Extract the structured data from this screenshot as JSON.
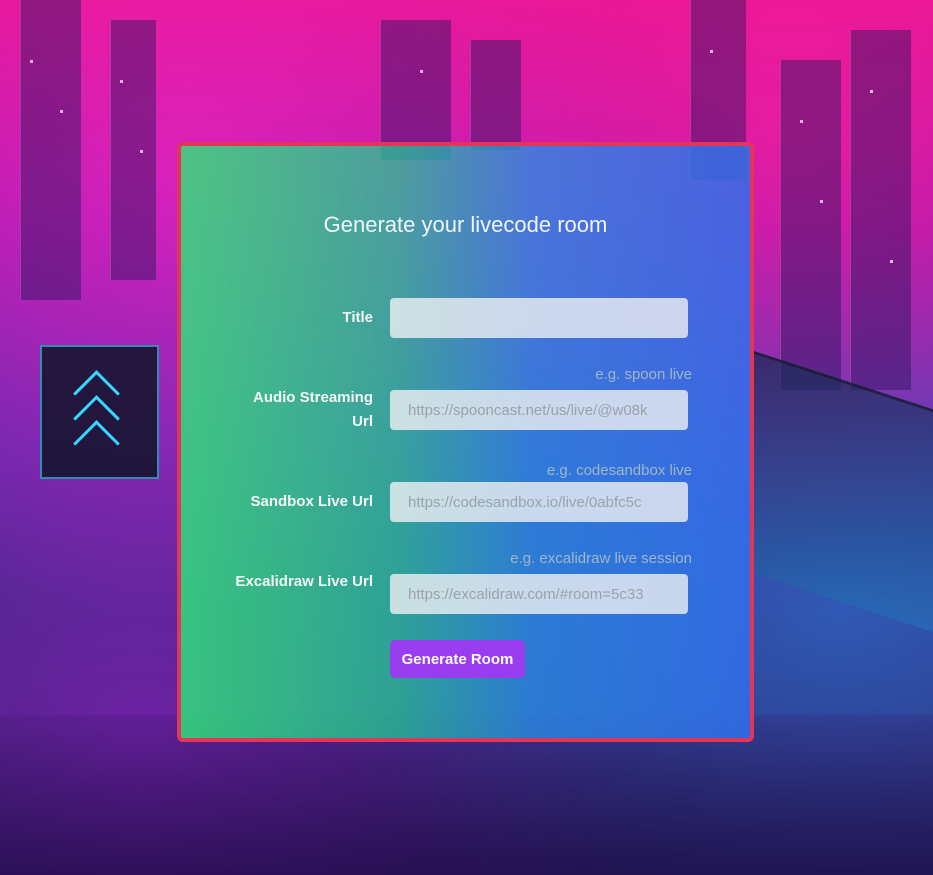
{
  "page": {
    "title": "Generate your livecode room"
  },
  "form": {
    "fields": [
      {
        "label": "Title",
        "value": "",
        "placeholder": "",
        "hint": ""
      },
      {
        "label": "Audio Streaming Url",
        "value": "",
        "placeholder": "https://spooncast.net/us/live/@w08k",
        "hint": "e.g. spoon live"
      },
      {
        "label": "Sandbox Live Url",
        "value": "",
        "placeholder": "https://codesandbox.io/live/0abfc5c",
        "hint": "e.g. codesandbox live"
      },
      {
        "label": "Excalidraw Live Url",
        "value": "",
        "placeholder": "https://excalidraw.com/#room=5c33",
        "hint": "e.g. excalidraw live session"
      }
    ],
    "submit_label": "Generate Room"
  },
  "colors": {
    "panel_border": "#e33558",
    "button": "#9a3cf0",
    "gradient_start": "#2ee678",
    "gradient_end": "#326eeb"
  }
}
